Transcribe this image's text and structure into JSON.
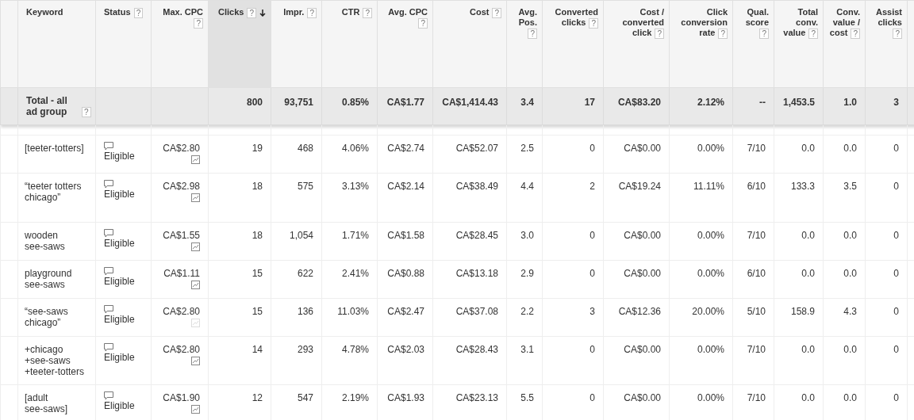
{
  "table": {
    "columns": [
      {
        "label": "Keyword",
        "sorted": false
      },
      {
        "label": "Status",
        "sorted": false,
        "help": "?"
      },
      {
        "label": "Max. CPC",
        "sorted": false,
        "help": "?"
      },
      {
        "label": "Clicks",
        "sorted": true,
        "help": "?"
      },
      {
        "label": "Impr.",
        "sorted": false,
        "help": "?"
      },
      {
        "label": "CTR",
        "sorted": false,
        "help": "?"
      },
      {
        "label": "Avg. CPC",
        "sorted": false,
        "help": "?"
      },
      {
        "label": "Cost",
        "sorted": false,
        "help": "?"
      },
      {
        "label": "Avg. Pos.",
        "sorted": false,
        "help": "?"
      },
      {
        "label": "Converted clicks",
        "sorted": false,
        "help": "?"
      },
      {
        "label": "Cost / converted click",
        "sorted": false,
        "help": "?"
      },
      {
        "label": "Click conversion rate",
        "sorted": false,
        "help": "?"
      },
      {
        "label": "Qual. score",
        "sorted": false,
        "help": "?"
      },
      {
        "label": "Total conv. value",
        "sorted": false,
        "help": "?"
      },
      {
        "label": "Conv. value / cost",
        "sorted": false,
        "help": "?"
      },
      {
        "label": "Assist clicks",
        "sorted": false,
        "help": "?"
      }
    ],
    "total": {
      "label": "Total - all ad group",
      "help": "?",
      "values": [
        "800",
        "93,751",
        "0.85%",
        "CA$1.77",
        "CA$1,414.43",
        "3.4",
        "17",
        "CA$83.20",
        "2.12%",
        "--",
        "1,453.5",
        "1.0",
        "3"
      ]
    },
    "rows": [
      {
        "keyword": "[teeter-totters]",
        "status": "Eligible",
        "max_cpc": "CA$2.80",
        "chart_enabled": true,
        "values": [
          "19",
          "468",
          "4.06%",
          "CA$2.74",
          "CA$52.07",
          "2.5",
          "0",
          "CA$0.00",
          "0.00%",
          "7/10",
          "0.0",
          "0.0",
          "0"
        ]
      },
      {
        "keyword": "“teeter totters chicago”",
        "status": "Eligible",
        "max_cpc": "CA$2.98",
        "chart_enabled": true,
        "values": [
          "18",
          "575",
          "3.13%",
          "CA$2.14",
          "CA$38.49",
          "4.4",
          "2",
          "CA$19.24",
          "11.11%",
          "6/10",
          "133.3",
          "3.5",
          "0"
        ]
      },
      {
        "keyword": "wooden see-saws",
        "status": "Eligible",
        "max_cpc": "CA$1.55",
        "chart_enabled": true,
        "values": [
          "18",
          "1,054",
          "1.71%",
          "CA$1.58",
          "CA$28.45",
          "3.0",
          "0",
          "CA$0.00",
          "0.00%",
          "7/10",
          "0.0",
          "0.0",
          "0"
        ]
      },
      {
        "keyword": "playground see-saws",
        "status": "Eligible",
        "max_cpc": "CA$1.11",
        "chart_enabled": true,
        "values": [
          "15",
          "622",
          "2.41%",
          "CA$0.88",
          "CA$13.18",
          "2.9",
          "0",
          "CA$0.00",
          "0.00%",
          "6/10",
          "0.0",
          "0.0",
          "0"
        ]
      },
      {
        "keyword": "“see-saws chicago”",
        "status": "Eligible",
        "max_cpc": "CA$2.80",
        "chart_enabled": false,
        "values": [
          "15",
          "136",
          "11.03%",
          "CA$2.47",
          "CA$37.08",
          "2.2",
          "3",
          "CA$12.36",
          "20.00%",
          "5/10",
          "158.9",
          "4.3",
          "0"
        ]
      },
      {
        "keyword": "+chicago +see-saws +teeter-totters",
        "status": "Eligible",
        "max_cpc": "CA$2.80",
        "chart_enabled": true,
        "values": [
          "14",
          "293",
          "4.78%",
          "CA$2.03",
          "CA$28.43",
          "3.1",
          "0",
          "CA$0.00",
          "0.00%",
          "7/10",
          "0.0",
          "0.0",
          "0"
        ]
      },
      {
        "keyword": "[adult see-saws]",
        "status": "Eligible",
        "max_cpc": "CA$1.90",
        "chart_enabled": true,
        "values": [
          "12",
          "547",
          "2.19%",
          "CA$1.93",
          "CA$23.13",
          "5.5",
          "0",
          "CA$0.00",
          "0.00%",
          "7/10",
          "0.0",
          "0.0",
          "0"
        ]
      }
    ]
  }
}
